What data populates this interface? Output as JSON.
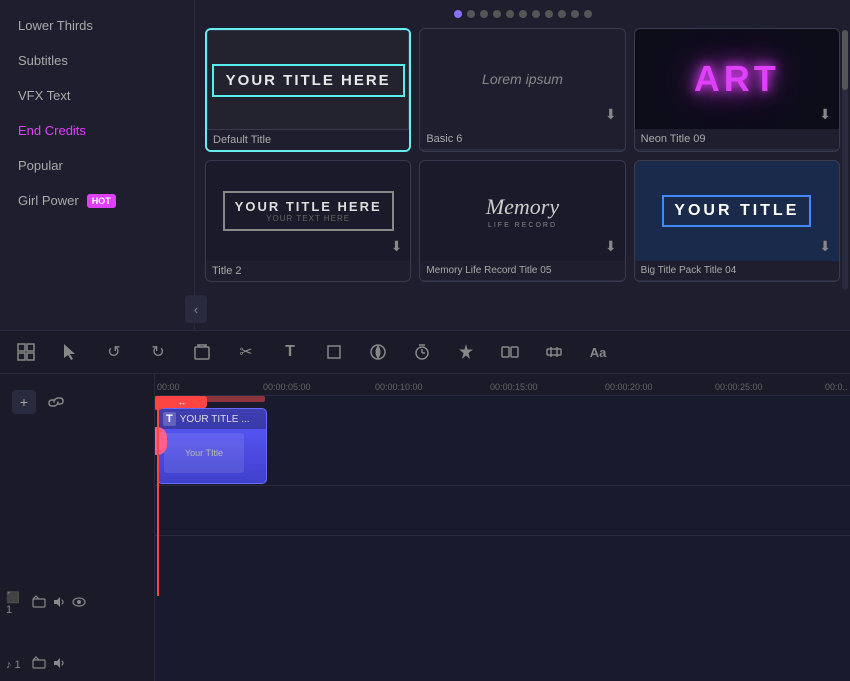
{
  "sidebar": {
    "items": [
      {
        "id": "lower-thirds",
        "label": "Lower Thirds",
        "active": false
      },
      {
        "id": "subtitles",
        "label": "Subtitles",
        "active": false
      },
      {
        "id": "vfx-text",
        "label": "VFX Text",
        "active": false
      },
      {
        "id": "end-credits",
        "label": "End Credits",
        "active": true
      },
      {
        "id": "popular",
        "label": "Popular",
        "active": false
      },
      {
        "id": "girl-power",
        "label": "Girl Power",
        "active": false,
        "badge": "HOT"
      }
    ]
  },
  "pagination": {
    "dots": 11,
    "active": 0
  },
  "templates": [
    {
      "id": "default-title",
      "label": "Default Title",
      "style": "default",
      "text": "YOUR TITLE HERE",
      "selected": true
    },
    {
      "id": "basic6",
      "label": "Basic 6",
      "style": "basic6",
      "text": "Lorem ipsum",
      "selected": false
    },
    {
      "id": "neon09",
      "label": "Neon Title 09",
      "style": "neon",
      "text": "ART",
      "selected": false
    },
    {
      "id": "title2",
      "label": "Title 2",
      "style": "title2",
      "text": "YOUR TITLE HERE",
      "subtext": "YOUR TEXT HERE",
      "selected": false
    },
    {
      "id": "memory",
      "label": "Memory Life Record Title 05",
      "style": "memory",
      "text": "Memory",
      "subtext": "LIFE RECORD",
      "selected": false
    },
    {
      "id": "bigtitle04",
      "label": "Big Title Pack Title 04",
      "style": "bigtitle",
      "text": "YOUR TITLE",
      "selected": false
    }
  ],
  "toolbar": {
    "icons": [
      {
        "id": "group",
        "symbol": "⊞",
        "label": "Group"
      },
      {
        "id": "select",
        "symbol": "↖",
        "label": "Select"
      },
      {
        "id": "undo",
        "symbol": "↺",
        "label": "Undo"
      },
      {
        "id": "redo",
        "symbol": "↻",
        "label": "Redo"
      },
      {
        "id": "delete",
        "symbol": "🗑",
        "label": "Delete"
      },
      {
        "id": "cut",
        "symbol": "✂",
        "label": "Cut"
      },
      {
        "id": "text",
        "symbol": "T",
        "label": "Text"
      },
      {
        "id": "crop",
        "symbol": "⬜",
        "label": "Crop"
      },
      {
        "id": "color",
        "symbol": "🎨",
        "label": "Color"
      },
      {
        "id": "timer",
        "symbol": "⏱",
        "label": "Timer"
      },
      {
        "id": "fx",
        "symbol": "✦",
        "label": "FX"
      },
      {
        "id": "split",
        "symbol": "⊟",
        "label": "Split"
      },
      {
        "id": "audio",
        "symbol": "♬",
        "label": "Audio"
      },
      {
        "id": "captions",
        "symbol": "Aa",
        "label": "Captions"
      }
    ]
  },
  "timeline": {
    "playhead_time": "00:00",
    "ruler_marks": [
      {
        "time": "00:00",
        "offset": 0
      },
      {
        "time": "00:00:05:00",
        "offset": 110
      },
      {
        "time": "00:00:10:00",
        "offset": 225
      },
      {
        "time": "00:00:15:00",
        "offset": 340
      },
      {
        "time": "00:00:20:00",
        "offset": 455
      },
      {
        "time": "00:00:25:00",
        "offset": 570
      },
      {
        "time": "00:0..",
        "offset": 680
      }
    ],
    "tracks": [
      {
        "id": "video-track",
        "number": "1",
        "type": "video"
      },
      {
        "id": "audio-track",
        "number": "1",
        "type": "audio"
      }
    ],
    "clip": {
      "label": "YOUR TITLE ...",
      "full_label": "Your TItle",
      "type": "title"
    }
  }
}
